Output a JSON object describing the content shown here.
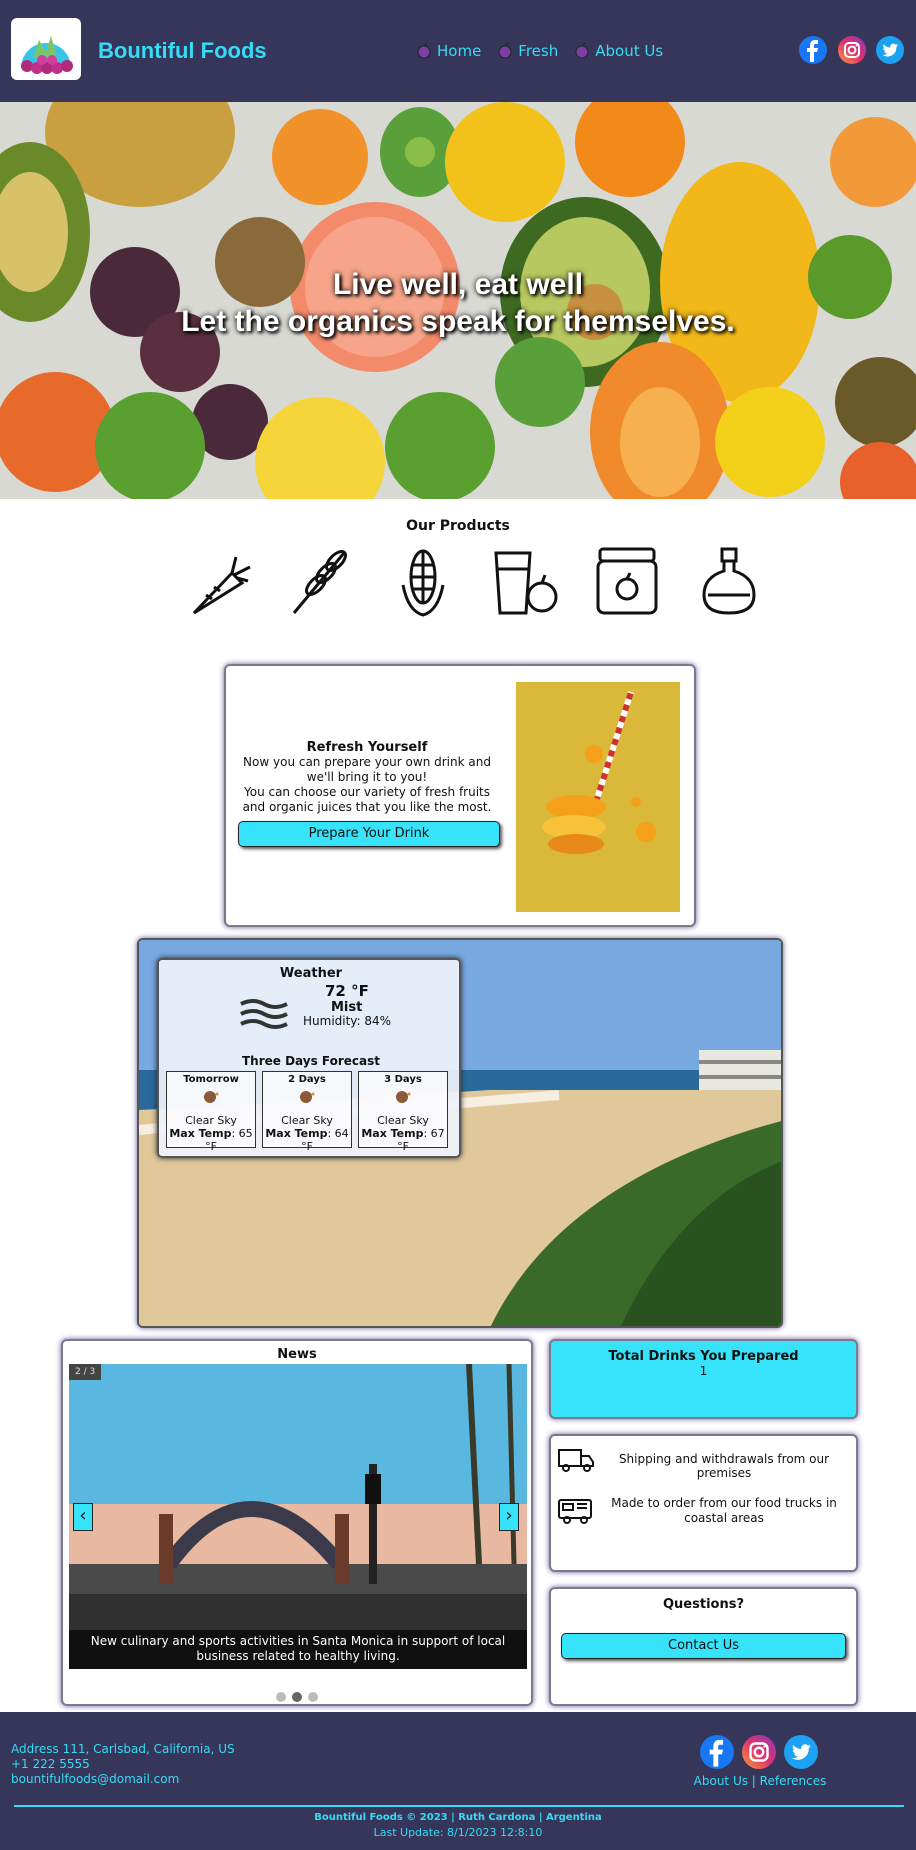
{
  "header": {
    "brand": "Bountiful Foods",
    "nav": [
      {
        "label": "Home",
        "icon": "grape-icon"
      },
      {
        "label": "Fresh",
        "icon": "grape-icon"
      },
      {
        "label": "About Us",
        "icon": "grape-icon"
      }
    ],
    "social": [
      "facebook-icon",
      "instagram-icon",
      "twitter-icon"
    ]
  },
  "hero": {
    "line1": "Live well, eat well",
    "line2": "Let the organics speak for themselves."
  },
  "products": {
    "title": "Our Products",
    "icons": [
      "carrot-icon",
      "wheat-icon",
      "corn-icon",
      "juice-apple-icon",
      "jam-jar-icon",
      "oil-bottle-icon"
    ]
  },
  "refresh": {
    "title": "Refresh Yourself",
    "line1": "Now you can prepare your own drink and we'll bring it to you!",
    "line2": "You can choose our variety of fresh fruits and organic juices that you like the most.",
    "button": "Prepare Your Drink"
  },
  "weather": {
    "title": "Weather",
    "temp": "72 °F",
    "condition": "Mist",
    "humidity": "Humidity: 84%",
    "forecast_title": "Three Days Forecast",
    "max_label": "Max Temp",
    "forecast": [
      {
        "day": "Tomorrow",
        "sky": "Clear Sky",
        "max": ": 65 °F"
      },
      {
        "day": "2 Days",
        "sky": "Clear Sky",
        "max": ": 64 °F"
      },
      {
        "day": "3 Days",
        "sky": "Clear Sky",
        "max": ": 67 °F"
      }
    ]
  },
  "news": {
    "title": "News",
    "counter": "2 / 3",
    "caption": "New culinary and sports activities in Santa Monica in support of local business related to healthy living.",
    "prev": "‹",
    "next": "›",
    "active_dot": 1
  },
  "drinks": {
    "title": "Total Drinks You Prepared",
    "count": "1"
  },
  "services": {
    "shipping": "Shipping and withdrawals from our premises",
    "trucks": "Made to order from our food trucks in coastal areas"
  },
  "questions": {
    "title": "Questions?",
    "button": "Contact Us"
  },
  "footer": {
    "address": "Address 111, Carlsbad, California, US",
    "phone": "+1 222 5555",
    "email": "bountifulfoods@domail.com",
    "links": "About Us | References",
    "copyright": "Bountiful Foods © 2023 | Ruth Cardona | Argentina",
    "updated": "Last Update: 8/1/2023 12:8:10"
  },
  "colors": {
    "header": "#36365a",
    "accent": "#36dbf5",
    "button": "#36e3fa"
  }
}
